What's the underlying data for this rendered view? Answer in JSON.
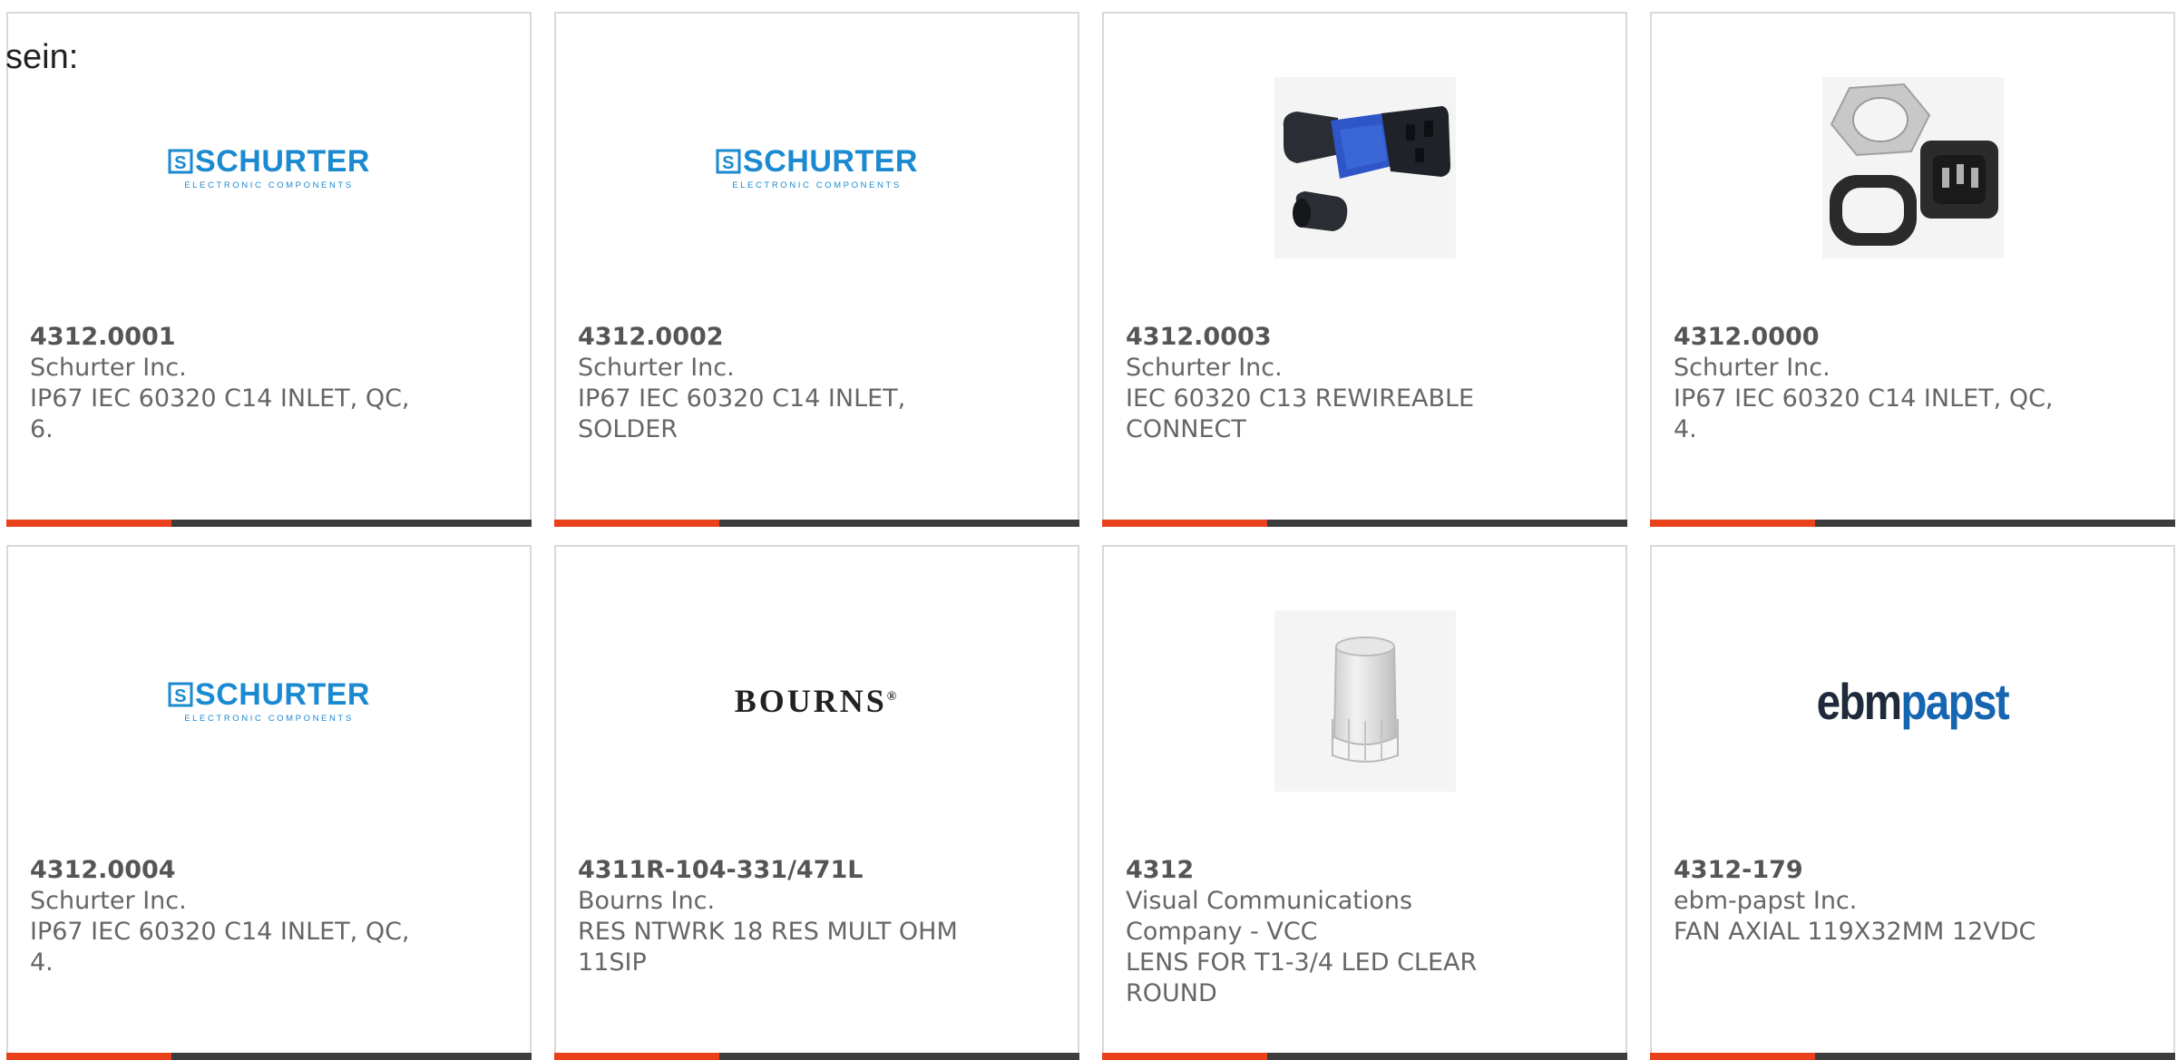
{
  "fragment_text": "sein:",
  "colors": {
    "accent": "#e8411c",
    "bar": "#3d3d3d",
    "schurter_blue": "#1b8ad0",
    "ebm_dark": "#1f2b3a",
    "ebm_blue": "#1565b0"
  },
  "logos": {
    "schurter_main": "SCHURTER",
    "schurter_sub": "ELECTRONIC COMPONENTS",
    "bourns": "BOURNS",
    "ebm_part1": "ebm",
    "ebm_part2": "papst"
  },
  "cards": [
    {
      "part_number": "4312.0001",
      "manufacturer": "Schurter Inc.",
      "description": "IP67 IEC 60320 C14 INLET, QC, 6.",
      "image": "schurter-logo"
    },
    {
      "part_number": "4312.0002",
      "manufacturer": "Schurter Inc.",
      "description": "IP67 IEC 60320 C14 INLET, SOLDER",
      "image": "schurter-logo"
    },
    {
      "part_number": "4312.0003",
      "manufacturer": "Schurter Inc.",
      "description": "IEC 60320 C13 REWIREABLE CONNECT",
      "image": "connector-photo"
    },
    {
      "part_number": "4312.0000",
      "manufacturer": "Schurter Inc.",
      "description": "IP67 IEC 60320 C14 INLET, QC, 4.",
      "image": "inlet-photo"
    },
    {
      "part_number": "4312.0004",
      "manufacturer": "Schurter Inc.",
      "description": "IP67 IEC 60320 C14 INLET, QC, 4.",
      "image": "schurter-logo"
    },
    {
      "part_number": "4311R-104-331/471L",
      "manufacturer": "Bourns Inc.",
      "description": "RES NTWRK 18 RES MULT OHM 11SIP",
      "image": "bourns-logo"
    },
    {
      "part_number": "4312",
      "manufacturer": "Visual Communications Company - VCC",
      "description": "LENS FOR T1-3/4 LED CLEAR ROUND",
      "image": "lens-photo"
    },
    {
      "part_number": "4312-179",
      "manufacturer": "ebm-papst Inc.",
      "description": "FAN AXIAL 119X32MM 12VDC",
      "image": "ebmpapst-logo"
    }
  ]
}
